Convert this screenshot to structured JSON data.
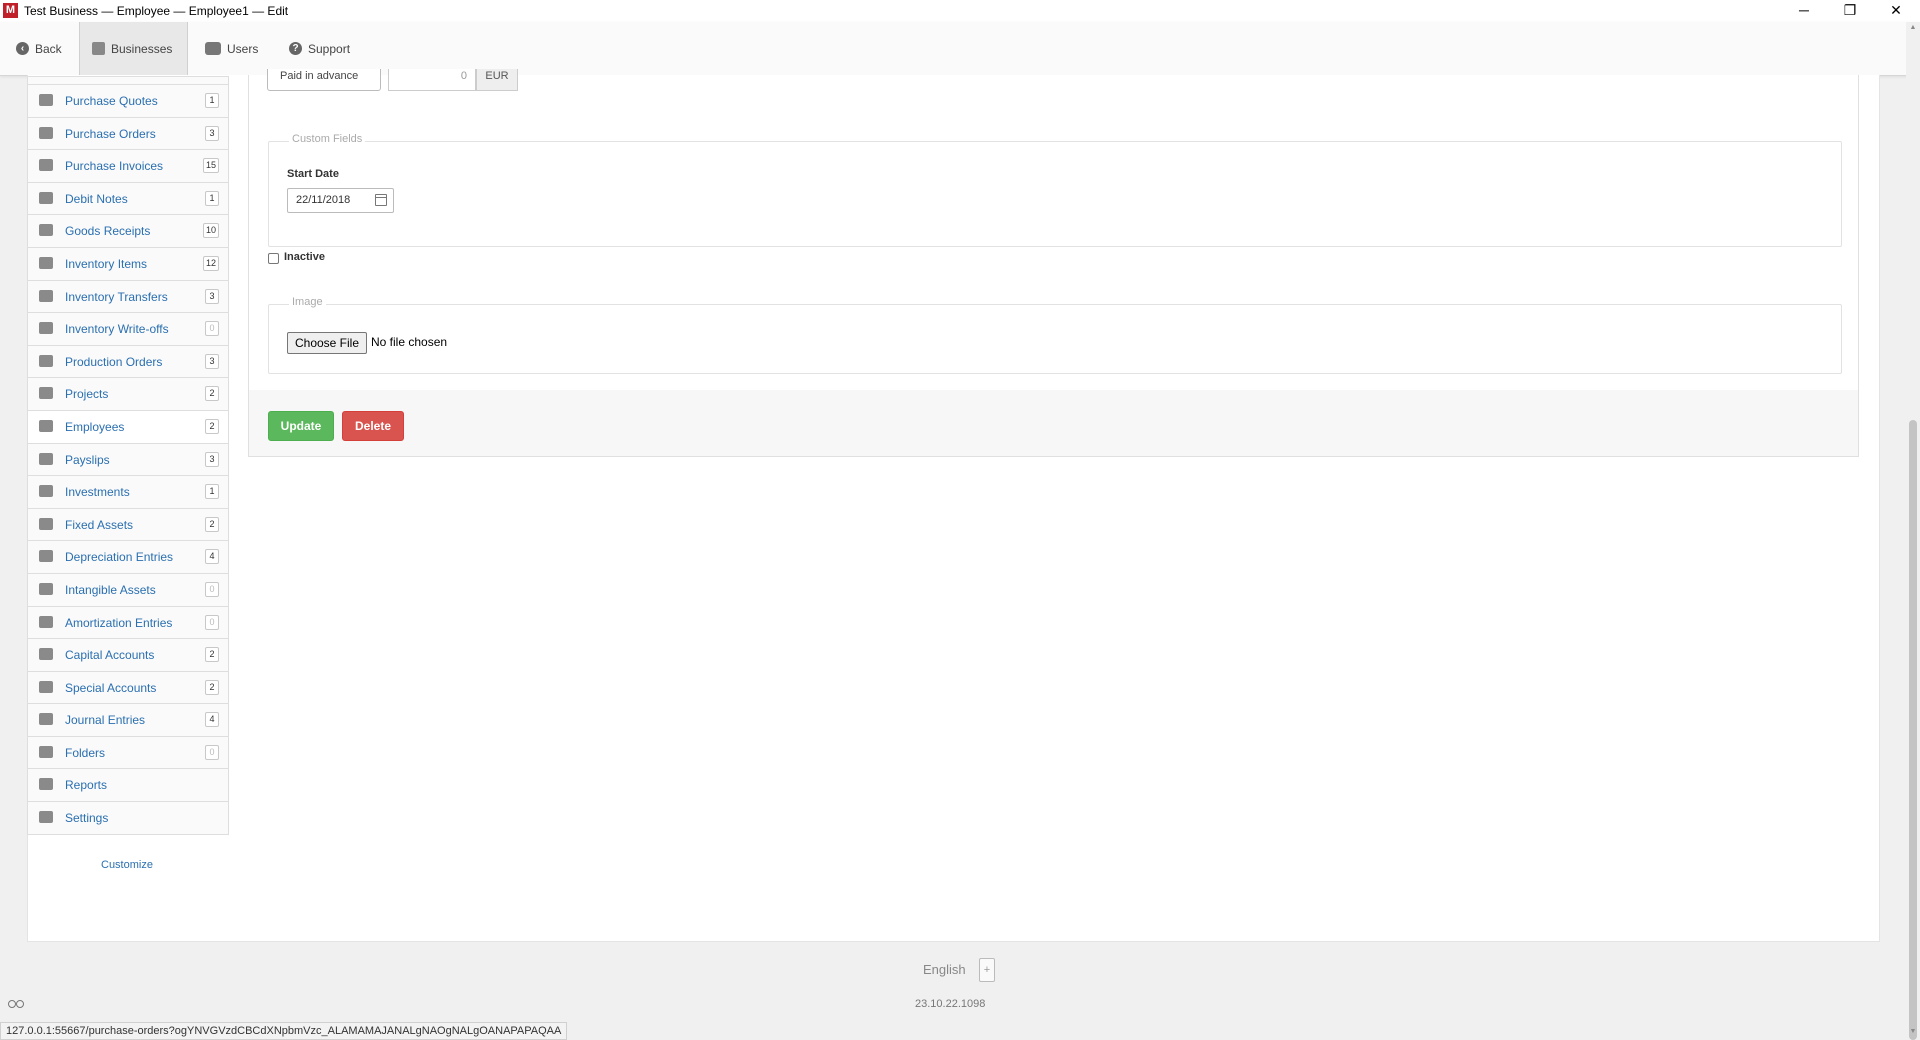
{
  "window": {
    "title": "Test Business — Employee — Employee1 — Edit",
    "app_icon_letter": "M",
    "minimize": "─",
    "restore": "❐",
    "close": "✕"
  },
  "toolbar": {
    "back": "Back",
    "businesses": "Businesses",
    "users": "Users",
    "support": "Support"
  },
  "sidebar": {
    "items": [
      {
        "label": "Purchase Quotes",
        "count": "1",
        "icon": "person-quote-icon"
      },
      {
        "label": "Purchase Orders",
        "count": "3",
        "icon": "cart-icon"
      },
      {
        "label": "Purchase Invoices",
        "count": "15",
        "icon": "document-icon"
      },
      {
        "label": "Debit Notes",
        "count": "1",
        "icon": "scissors-icon"
      },
      {
        "label": "Goods Receipts",
        "count": "10",
        "icon": "truck-icon"
      },
      {
        "label": "Inventory Items",
        "count": "12",
        "icon": "boxes-icon"
      },
      {
        "label": "Inventory Transfers",
        "count": "3",
        "icon": "dolly-icon"
      },
      {
        "label": "Inventory Write-offs",
        "count": "0",
        "icon": "eraser-icon"
      },
      {
        "label": "Production Orders",
        "count": "3",
        "icon": "factory-icon"
      },
      {
        "label": "Projects",
        "count": "2",
        "icon": "chart-icon"
      },
      {
        "label": "Employees",
        "count": "2",
        "icon": "id-card-icon"
      },
      {
        "label": "Payslips",
        "count": "3",
        "icon": "money-icon"
      },
      {
        "label": "Investments",
        "count": "1",
        "icon": "pie-icon"
      },
      {
        "label": "Fixed Assets",
        "count": "2",
        "icon": "building-icon"
      },
      {
        "label": "Depreciation Entries",
        "count": "4",
        "icon": "sort-down-icon"
      },
      {
        "label": "Intangible Assets",
        "count": "0",
        "icon": "stack-icon"
      },
      {
        "label": "Amortization Entries",
        "count": "0",
        "icon": "sort-down-icon"
      },
      {
        "label": "Capital Accounts",
        "count": "2",
        "icon": "chart-line-icon"
      },
      {
        "label": "Special Accounts",
        "count": "2",
        "icon": "users-icon"
      },
      {
        "label": "Journal Entries",
        "count": "4",
        "icon": "balance-scale-icon"
      },
      {
        "label": "Folders",
        "count": "0",
        "icon": "folder-icon"
      },
      {
        "label": "Reports",
        "count": "",
        "icon": "printer-icon"
      },
      {
        "label": "Settings",
        "count": "",
        "icon": "gear-icon"
      }
    ],
    "customize": "Customize"
  },
  "form": {
    "payment_select": "Paid in advance",
    "amount_value": "0",
    "currency": "EUR",
    "custom_fields_legend": "Custom Fields",
    "start_date_label": "Start Date",
    "start_date_value": "22/11/2018",
    "inactive_label": "Inactive",
    "image_legend": "Image",
    "choose_file": "Choose File",
    "file_status": "No file chosen",
    "update": "Update",
    "delete": "Delete"
  },
  "footer": {
    "language": "English",
    "language_add": "+",
    "version": "23.10.22.1098",
    "status_url": "127.0.0.1:55667/purchase-orders?ogYNVGVzdCBCdXNpbmVzc_ALAMAMAJANALgNAOgNALgOANAPAPAQAA"
  }
}
